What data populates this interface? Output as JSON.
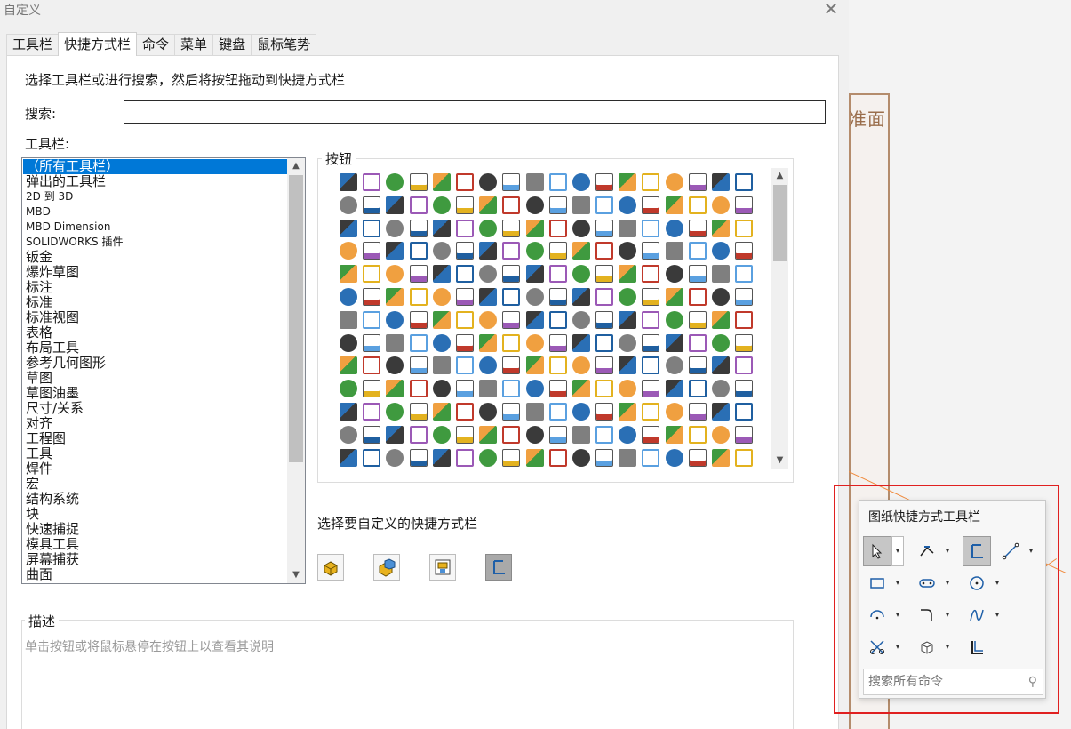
{
  "window": {
    "title": "自定义",
    "close_glyph": "✕"
  },
  "tabs": [
    {
      "label": "工具栏",
      "active": false
    },
    {
      "label": "快捷方式栏",
      "active": true
    },
    {
      "label": "命令",
      "active": false
    },
    {
      "label": "菜单",
      "active": false
    },
    {
      "label": "键盘",
      "active": false
    },
    {
      "label": "鼠标笔势",
      "active": false
    }
  ],
  "instruction": "选择工具栏或进行搜索，然后将按钮拖动到快捷方式栏",
  "search": {
    "label": "搜索:",
    "value": ""
  },
  "toolbars": {
    "label": "工具栏:",
    "items": [
      "（所有工具栏）",
      "弹出的工具栏",
      "2D 到 3D",
      "MBD",
      "MBD Dimension",
      "SOLIDWORKS 插件",
      "钣金",
      "爆炸草图",
      "标注",
      "标准",
      "标准视图",
      "表格",
      "布局工具",
      "参考几何图形",
      "草图",
      "草图油墨",
      "尺寸/关系",
      "对齐",
      "工程图",
      "工具",
      "焊件",
      "宏",
      "结构系统",
      "块",
      "快速捕捉",
      "模具工具",
      "屏幕捕获",
      "曲面"
    ],
    "selected_index": 0
  },
  "buttons": {
    "label": "按钮",
    "icon_count": 234
  },
  "icon_palette": [
    "#2a6fb5",
    "#e3b21f",
    "#3a3a3a",
    "#5aa0e0",
    "#3f9a3f",
    "#c0392b",
    "#7f7f7f",
    "#9b59b6",
    "#f0a040",
    "#1f5fa0"
  ],
  "choose": {
    "label": "选择要自定义的快捷方式栏",
    "buttons": [
      {
        "icon": "part-shortcut-icon",
        "active": false
      },
      {
        "icon": "assembly-shortcut-icon",
        "active": false
      },
      {
        "icon": "drawing-shortcut-icon",
        "active": false
      },
      {
        "icon": "sketch-shortcut-icon",
        "active": true
      }
    ]
  },
  "description": {
    "label": "描述",
    "text": "单击按钮或将鼠标悬停在按钮上以查看其说明"
  },
  "popup": {
    "title": "图纸快捷方式工具栏",
    "search_placeholder": "搜索所有命令",
    "rows": [
      [
        "select-icon",
        "smart-dimension-icon",
        "offset-entities-icon",
        "line-icon"
      ],
      [
        "rectangle-icon",
        "slot-icon",
        "circle-icon"
      ],
      [
        "arc-icon",
        "fillet-icon",
        "spline-icon"
      ],
      [
        "trim-icon",
        "view-orientation-icon",
        "convert-entities-icon"
      ]
    ]
  },
  "viewport": {
    "label": "准面"
  }
}
